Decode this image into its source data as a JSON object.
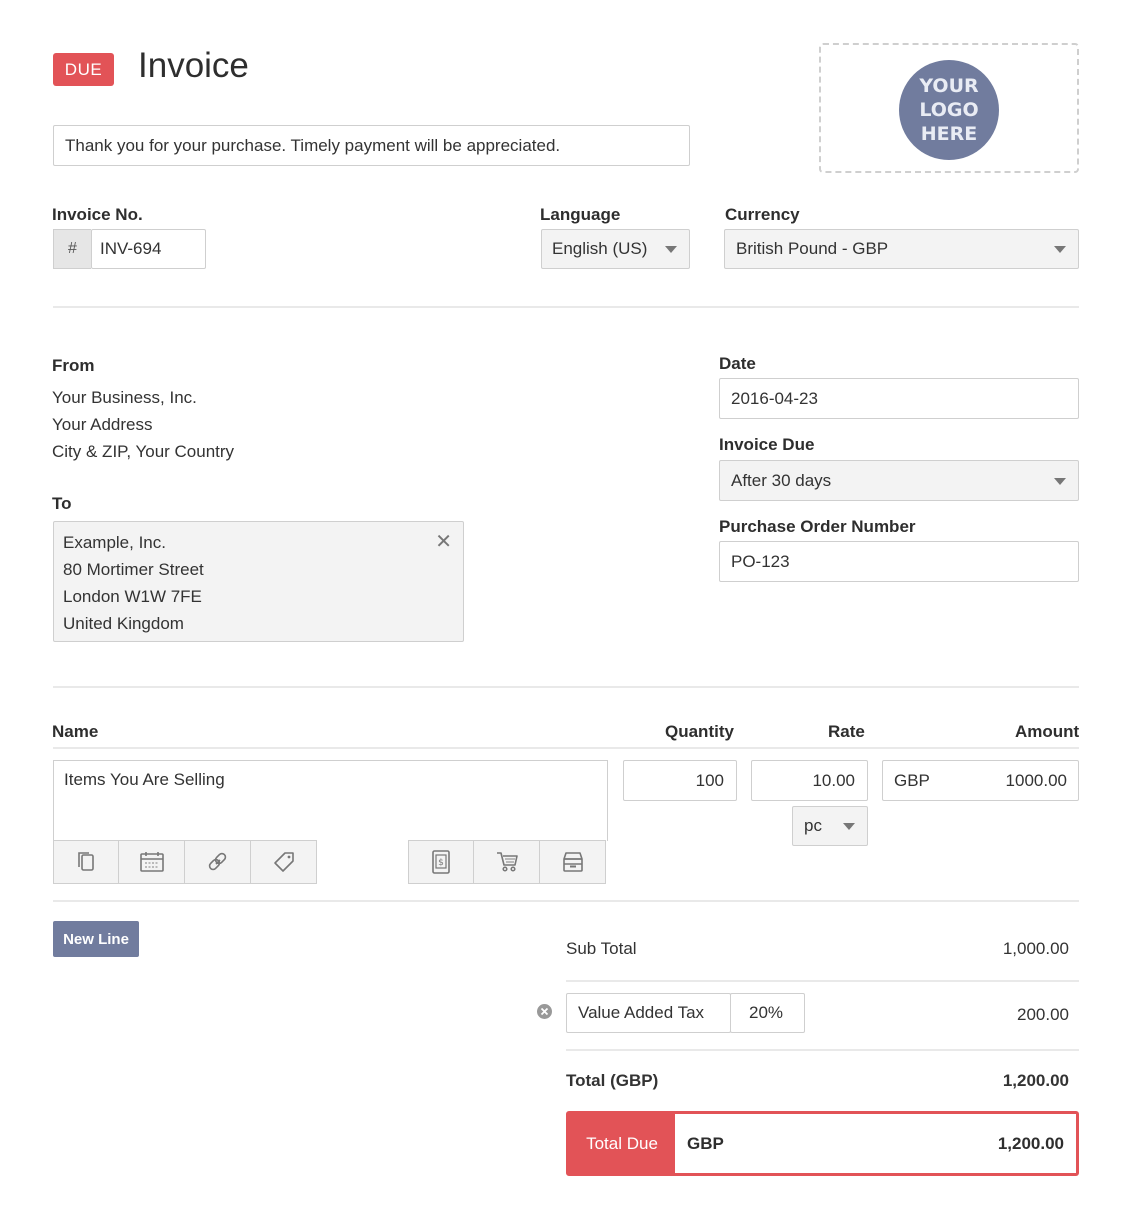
{
  "header": {
    "status_badge": "DUE",
    "title": "Invoice",
    "notes": "Thank you for your purchase. Timely payment will be appreciated.",
    "logo_text": [
      "YOUR",
      "LOGO",
      "HERE"
    ]
  },
  "invoice_no": {
    "label": "Invoice No.",
    "prefix": "#",
    "value": "INV-694"
  },
  "language": {
    "label": "Language",
    "value": "English (US)"
  },
  "currency": {
    "label": "Currency",
    "value": "British Pound - GBP"
  },
  "from": {
    "label": "From",
    "lines": [
      "Your Business, Inc.",
      "Your Address",
      "City & ZIP, Your Country"
    ]
  },
  "to": {
    "label": "To",
    "lines": [
      "Example, Inc.",
      "80 Mortimer Street",
      "London W1W 7FE",
      "United Kingdom"
    ]
  },
  "date": {
    "label": "Date",
    "value": "2016-04-23"
  },
  "invoice_due": {
    "label": "Invoice Due",
    "value": "After 30 days"
  },
  "po": {
    "label": "Purchase Order Number",
    "value": "PO-123"
  },
  "items": {
    "headers": {
      "name": "Name",
      "quantity": "Quantity",
      "rate": "Rate",
      "amount": "Amount"
    },
    "rows": [
      {
        "name": "Items You Are Selling",
        "quantity": "100",
        "rate": "10.00",
        "unit": "pc",
        "currency": "GBP",
        "amount": "1000.00"
      }
    ],
    "tool_icons": [
      "copy-icon",
      "calendar-icon",
      "link-icon",
      "tag-icon",
      "receipt-icon",
      "cart-icon",
      "store-icon"
    ]
  },
  "new_line_label": "New Line",
  "totals": {
    "subtotal_label": "Sub Total",
    "subtotal_value": "1,000.00",
    "tax_name": "Value Added Tax",
    "tax_rate": "20%",
    "tax_value": "200.00",
    "total_label": "Total (GBP)",
    "total_value": "1,200.00",
    "due_label": "Total Due",
    "due_currency": "GBP",
    "due_value": "1,200.00"
  },
  "colors": {
    "accent_red": "#e25357",
    "accent_slate": "#717c9e"
  }
}
